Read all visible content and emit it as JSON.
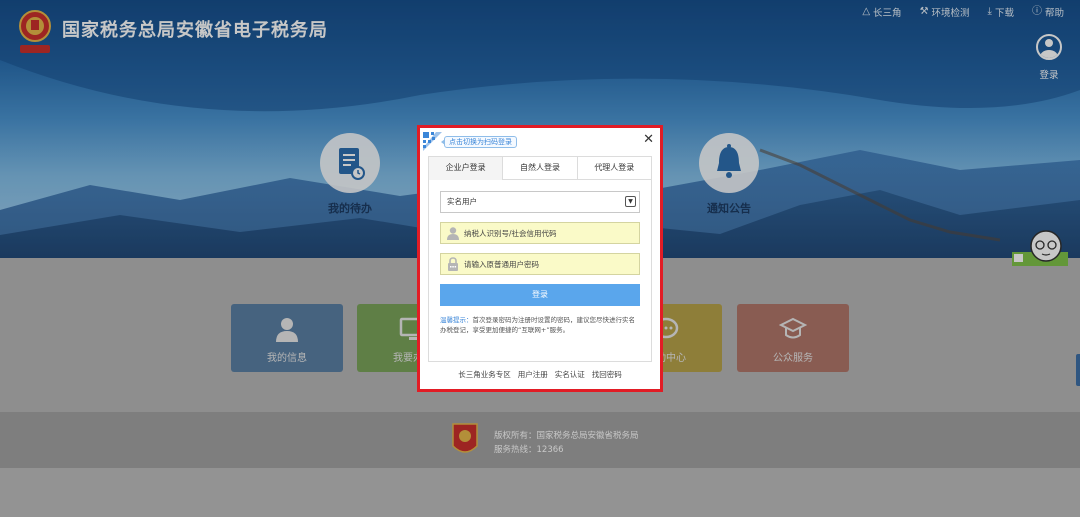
{
  "header": {
    "site_title": "国家税务总局安徽省电子税务局",
    "top_links": [
      {
        "label": "长三角",
        "icon": "triangle-icon"
      },
      {
        "label": "环境检测",
        "icon": "wrench-icon"
      },
      {
        "label": "下载",
        "icon": "download-icon"
      },
      {
        "label": "帮助",
        "icon": "help-icon"
      }
    ],
    "login_label": "登录"
  },
  "banner_features": [
    {
      "label": "我的待办",
      "icon": "todo-document-icon"
    },
    {
      "label": "通知公告",
      "icon": "bell-icon"
    }
  ],
  "tiles": [
    {
      "label": "我的信息",
      "icon": "person-icon"
    },
    {
      "label": "我要办税",
      "icon": "monitor-icon"
    },
    {
      "label": "",
      "icon": "hidden-tile-icon"
    },
    {
      "label": "互动中心",
      "icon": "chat-icon"
    },
    {
      "label": "公众服务",
      "icon": "graduation-cap-icon"
    }
  ],
  "footer": {
    "copyright": "版权所有：国家税务总局安徽省税务局",
    "hotline": "服务热线：12366"
  },
  "modal": {
    "qr_tip": "点击切换为扫码登录",
    "close_symbol": "✕",
    "tabs": [
      {
        "label": "企业户登录",
        "active": true
      },
      {
        "label": "自然人登录",
        "active": false
      },
      {
        "label": "代理人登录",
        "active": false
      }
    ],
    "user_type": {
      "selected": "实名用户"
    },
    "taxpayer_id_placeholder": "纳税人识别号/社会信用代码",
    "password_placeholder": "请输入原普通用户密码",
    "login_button": "登录",
    "hint_label": "温馨提示：",
    "hint_text": "首次登录密码为注册时设置的密码，建议您尽快进行实名办税登记，享受更加便捷的“互联网+”服务。",
    "links": [
      "长三角业务专区",
      "用户注册",
      "实名认证",
      "找回密码"
    ]
  },
  "colors": {
    "highlight_border": "#e21c25",
    "login_button": "#5aa6ec",
    "input_fill": "#fafac8",
    "banner_blue": "#2a6fb0"
  }
}
